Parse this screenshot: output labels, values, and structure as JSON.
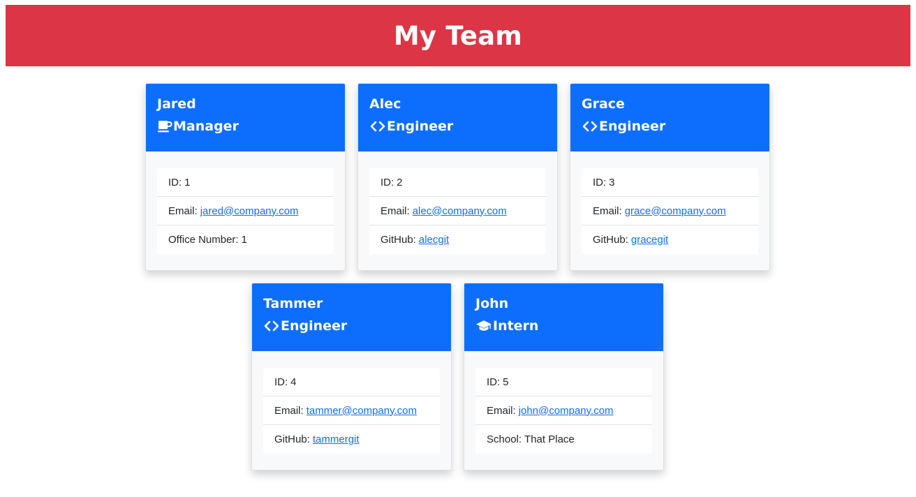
{
  "page": {
    "title": "My Team"
  },
  "colors": {
    "banner": "#dc3545",
    "card_header": "#0d6efd",
    "link": "#0d6efd"
  },
  "team": [
    {
      "name": "Jared",
      "role": "Manager",
      "icon": "coffee-mug-icon",
      "id_label": "ID:",
      "id": "1",
      "email_label": "Email:",
      "email": "jared@company.com",
      "extra_label": "Office Number:",
      "extra_value": "1"
    },
    {
      "name": "Alec",
      "role": "Engineer",
      "icon": "code-brackets-icon",
      "id_label": "ID:",
      "id": "2",
      "email_label": "Email:",
      "email": "alec@company.com",
      "extra_label": "GitHub:",
      "extra_value": "alecgit"
    },
    {
      "name": "Grace",
      "role": "Engineer",
      "icon": "code-brackets-icon",
      "id_label": "ID:",
      "id": "3",
      "email_label": "Email:",
      "email": "grace@company.com",
      "extra_label": "GitHub:",
      "extra_value": "gracegit"
    },
    {
      "name": "Tammer",
      "role": "Engineer",
      "icon": "code-brackets-icon",
      "id_label": "ID:",
      "id": "4",
      "email_label": "Email:",
      "email": "tammer@company.com",
      "extra_label": "GitHub:",
      "extra_value": "tammergit"
    },
    {
      "name": "John",
      "role": "Intern",
      "icon": "graduation-cap-icon",
      "id_label": "ID:",
      "id": "5",
      "email_label": "Email:",
      "email": "john@company.com",
      "extra_label": "School:",
      "extra_value": "That Place"
    }
  ]
}
